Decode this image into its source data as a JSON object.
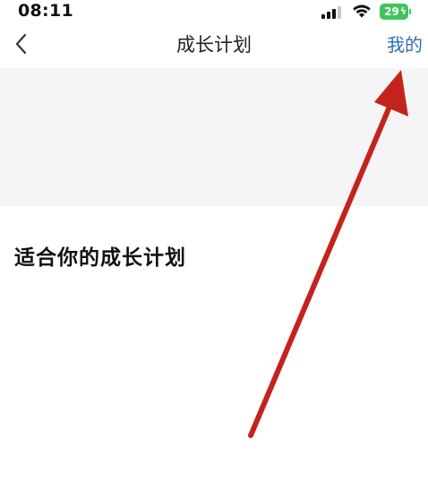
{
  "status_bar": {
    "time": "08:11",
    "battery_level": "29",
    "battery_icon": "charging-bolt"
  },
  "nav": {
    "back_icon": "chevron-left-icon",
    "title": "成长计划",
    "right_link": "我的"
  },
  "content": {
    "section_heading": "适合你的成长计划"
  },
  "colors": {
    "accent_link": "#2f6fb2",
    "battery": "#3fc35b",
    "banner_bg": "#f5f5f7",
    "annotation": "#c4231d"
  }
}
